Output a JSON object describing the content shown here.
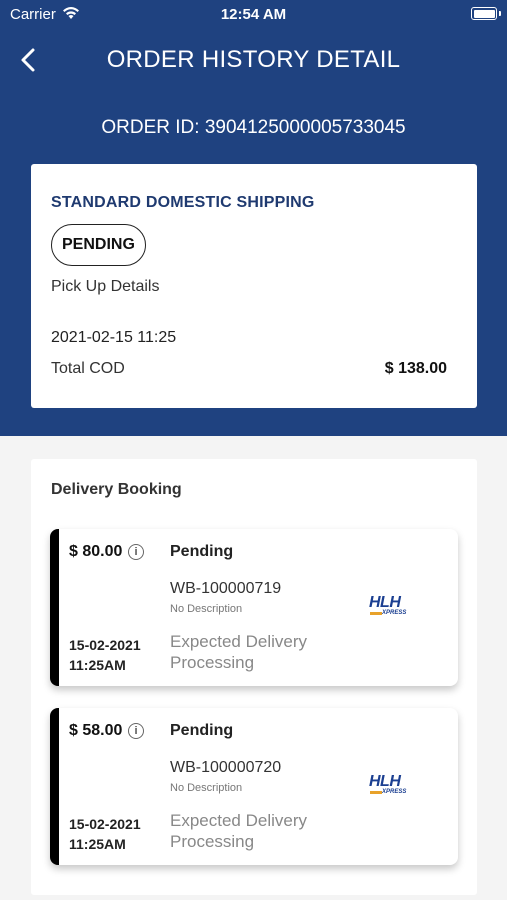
{
  "status_bar": {
    "carrier": "Carrier",
    "time": "12:54 AM"
  },
  "header": {
    "title": "ORDER HISTORY DETAIL",
    "order_id": "ORDER ID: 3904125000005733045"
  },
  "summary": {
    "shipping_type": "STANDARD DOMESTIC SHIPPING",
    "status": "PENDING",
    "pickup_label": "Pick Up Details",
    "date": "2021-02-15 11:25",
    "total_cod_label": "Total COD",
    "total_cod_amount": "$ 138.00"
  },
  "delivery": {
    "title": "Delivery Booking",
    "items": [
      {
        "price": "$ 80.00",
        "status": "Pending",
        "waybill": "WB-100000719",
        "description": "No Description",
        "date": "15-02-2021",
        "time": "11:25AM",
        "expected_label": "Expected Delivery",
        "expected_value": "Processing",
        "courier_logo": "HLH",
        "courier_sub": "XPRESS"
      },
      {
        "price": "$ 58.00",
        "status": "Pending",
        "waybill": "WB-100000720",
        "description": "No Description",
        "date": "15-02-2021",
        "time": "11:25AM",
        "expected_label": "Expected Delivery",
        "expected_value": "Processing",
        "courier_logo": "HLH",
        "courier_sub": "XPRESS"
      }
    ]
  },
  "icons": {
    "back": "chevron-left-icon",
    "wifi": "wifi-icon",
    "battery": "battery-icon",
    "info": "info-icon"
  },
  "colors": {
    "header_bg": "#1f4280",
    "accent_text": "#1f3a70",
    "booking_bar": "#000000"
  }
}
